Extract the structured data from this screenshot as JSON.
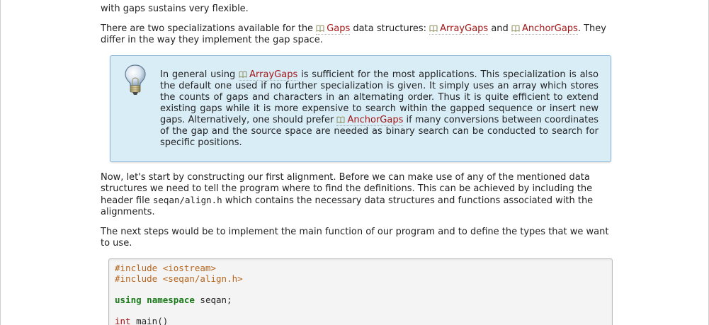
{
  "paragraphs": {
    "top": {
      "line_tail": "with gaps sustains very flexible."
    },
    "two": {
      "t1": "There are two specializations available for the ",
      "ref1": "Gaps",
      "t2": " data structures: ",
      "ref2": "ArrayGaps",
      "t3": " and ",
      "ref3": "AnchorGaps",
      "t4": ". They differ in the way they implement the gap space."
    },
    "now": {
      "t1": "Now, let's start by constructing our first alignment. Before we can make use of any of the mentioned data structures we need to tell the program where to find the definitions. This can be achieved by including the header file ",
      "code": "seqan/align.h",
      "t2": " which contains the necessary data structures and functions associated with the alignments."
    },
    "next": {
      "text": "The next steps would be to implement the main function of our program and to define the types that we want to use."
    }
  },
  "tip": {
    "icon": "lightbulb-icon",
    "t1": "In general using ",
    "ref1": "ArrayGaps",
    "t2": " is sufficient for the most applications. This specialization is also the default one used if no further specialization is given. It simply uses an array which stores the counts of gaps and characters in an alternating order. Thus it is quite efficient to extend existing gaps while it is more expensive to search within the gapped sequence or insert new gaps. Alternatively, one should prefer ",
    "ref2": "AnchorGaps",
    "t3": " if many conversions between coordinates of the gap and the source space are needed as binary search can be conducted to search for specific positions."
  },
  "code_block": {
    "lines": [
      "#include <iostream>",
      "#include <seqan/align.h>",
      "",
      "using namespace seqan;",
      "",
      "int main()"
    ],
    "kw_using": "using",
    "kw_namespace": "namespace",
    "ns_name": " seqan;",
    "kw_int": "int",
    "fn_main": " main()"
  },
  "icons": {
    "ref_icon": "book-icon"
  },
  "colors": {
    "link": "#a31515",
    "tip_bg": "#d9edf7",
    "tip_border": "#8fb8d6",
    "code_bg": "#f4f4f4",
    "preprocessor": "#b5651d",
    "keyword": "#1a7a1a"
  }
}
